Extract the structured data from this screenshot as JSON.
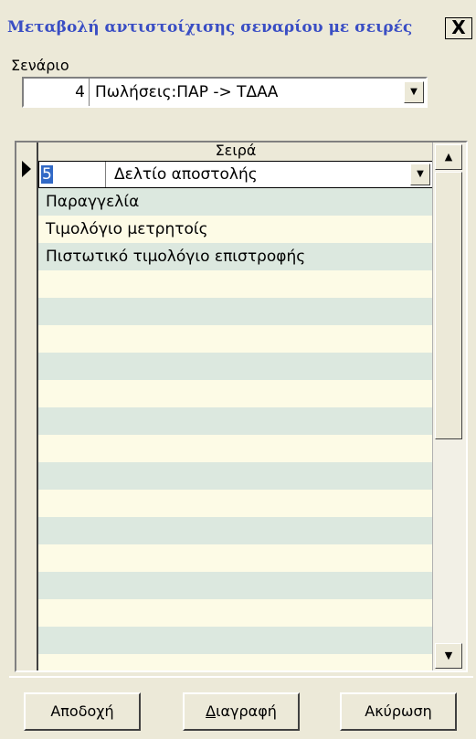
{
  "window": {
    "title": "Μεταβολή αντιστοίχισης σεναρίου με σειρές",
    "close_label": "X"
  },
  "scenario": {
    "label": "Σενάριο",
    "number": "4",
    "value": "Πωλήσεις:ΠΑΡ -> ΤΔΑΑ"
  },
  "grid": {
    "column_header": "Σειρά",
    "edit_row": {
      "code": "5",
      "value": "Δελτίο αποστολής"
    },
    "rows": [
      "Παραγγελία",
      "Τιμολόγιο μετρητοίς",
      "Πιστωτικό τιμολόγιο επιστροφής"
    ]
  },
  "buttons": {
    "accept": "Αποδοχή",
    "delete_prefix": "Δ",
    "delete_rest": "ιαγραφή",
    "cancel": "Ακύρωση"
  },
  "icons": {
    "dropdown": "chevron-down-icon",
    "row_indicator": "row-pointer-icon",
    "scroll_up": "scroll-up-icon",
    "scroll_down": "scroll-down-icon"
  }
}
